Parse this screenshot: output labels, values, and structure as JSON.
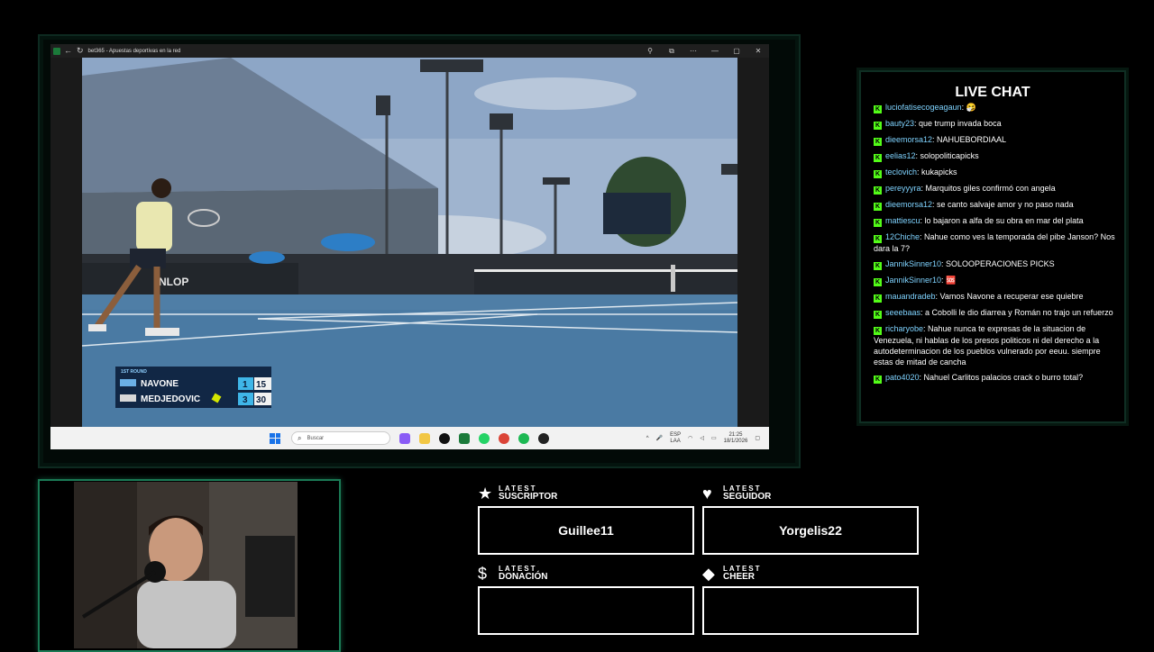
{
  "browser": {
    "tab_title": "bet365 - Apuestas deportivas en la red",
    "controls": {
      "extension": "⚲",
      "collections": "⧉",
      "menu": "⋯",
      "minimize": "—",
      "maximize": "▢",
      "close": "✕"
    }
  },
  "scoreboard": {
    "round": "1ST ROUND",
    "players": [
      {
        "name": "NAVONE",
        "sets": "1",
        "points": "15"
      },
      {
        "name": "MEDJEDOVIC",
        "sets": "3",
        "points": "30"
      }
    ],
    "sponsor": "NLOP"
  },
  "taskbar": {
    "search_placeholder": "Buscar",
    "lang_top": "ESP",
    "lang_bottom": "LAA",
    "time": "21:25",
    "date": "18/1/2026"
  },
  "chat": {
    "title": "LIVE CHAT",
    "messages": [
      {
        "user": "luciofatisecogeagaun",
        "text": ": 🤧"
      },
      {
        "user": "bauty23",
        "text": ": que trump invada boca"
      },
      {
        "user": "dieemorsa12",
        "text": ": NAHUEBORDIAAL"
      },
      {
        "user": "eelias12",
        "text": ": solopoliticapicks"
      },
      {
        "user": "teclovich",
        "text": ": kukapicks"
      },
      {
        "user": "pereyyyra",
        "text": ": Marquitos giles confirmó con angela"
      },
      {
        "user": "dieemorsa12",
        "text": ": se canto salvaje amor y no paso nada"
      },
      {
        "user": "mattiescu",
        "text": ": lo bajaron a alfa de su obra en mar del plata"
      },
      {
        "user": "12Chiche",
        "text": ": Nahue como ves la temporada del pibe Janson? Nos dara la 7?"
      },
      {
        "user": "JannikSinner10",
        "text": ": SOLOOPERACIONES PICKS"
      },
      {
        "user": "JannikSinner10",
        "text": ": 🆘"
      },
      {
        "user": "mauandradeb",
        "text": ": Vamos Navone a recuperar ese quiebre"
      },
      {
        "user": "seeebaas",
        "text": ": a Cobolli le dio diarrea y Román no trajo un refuerzo"
      },
      {
        "user": "richaryobe",
        "text": ": Nahue nunca te expresas de la situacion de Venezuela, ni hablas de los presos politicos ni del derecho a la autodeterminacion de los pueblos vulnerado por eeuu. siempre estas de mitad de cancha"
      },
      {
        "user": "pato4020",
        "text": ": Nahuel Carlitos palacios crack o burro total?"
      }
    ]
  },
  "widgets": [
    {
      "icon": "★",
      "label_top": "LATEST",
      "label_bottom": "SUSCRIPTOR",
      "value": "Guillee11"
    },
    {
      "icon": "♥",
      "label_top": "LATEST",
      "label_bottom": "SEGUIDOR",
      "value": "Yorgelis22"
    },
    {
      "icon": "$",
      "label_top": "LATEST",
      "label_bottom": "DONACIÓN",
      "value": ""
    },
    {
      "icon": "◆",
      "label_top": "LATEST",
      "label_bottom": "CHEER",
      "value": ""
    }
  ],
  "colors": {
    "accent": "#1b7a55",
    "kick_green": "#53fc18",
    "chat_user": "#7fd3ff",
    "court_blue": "#4f7ea6"
  }
}
